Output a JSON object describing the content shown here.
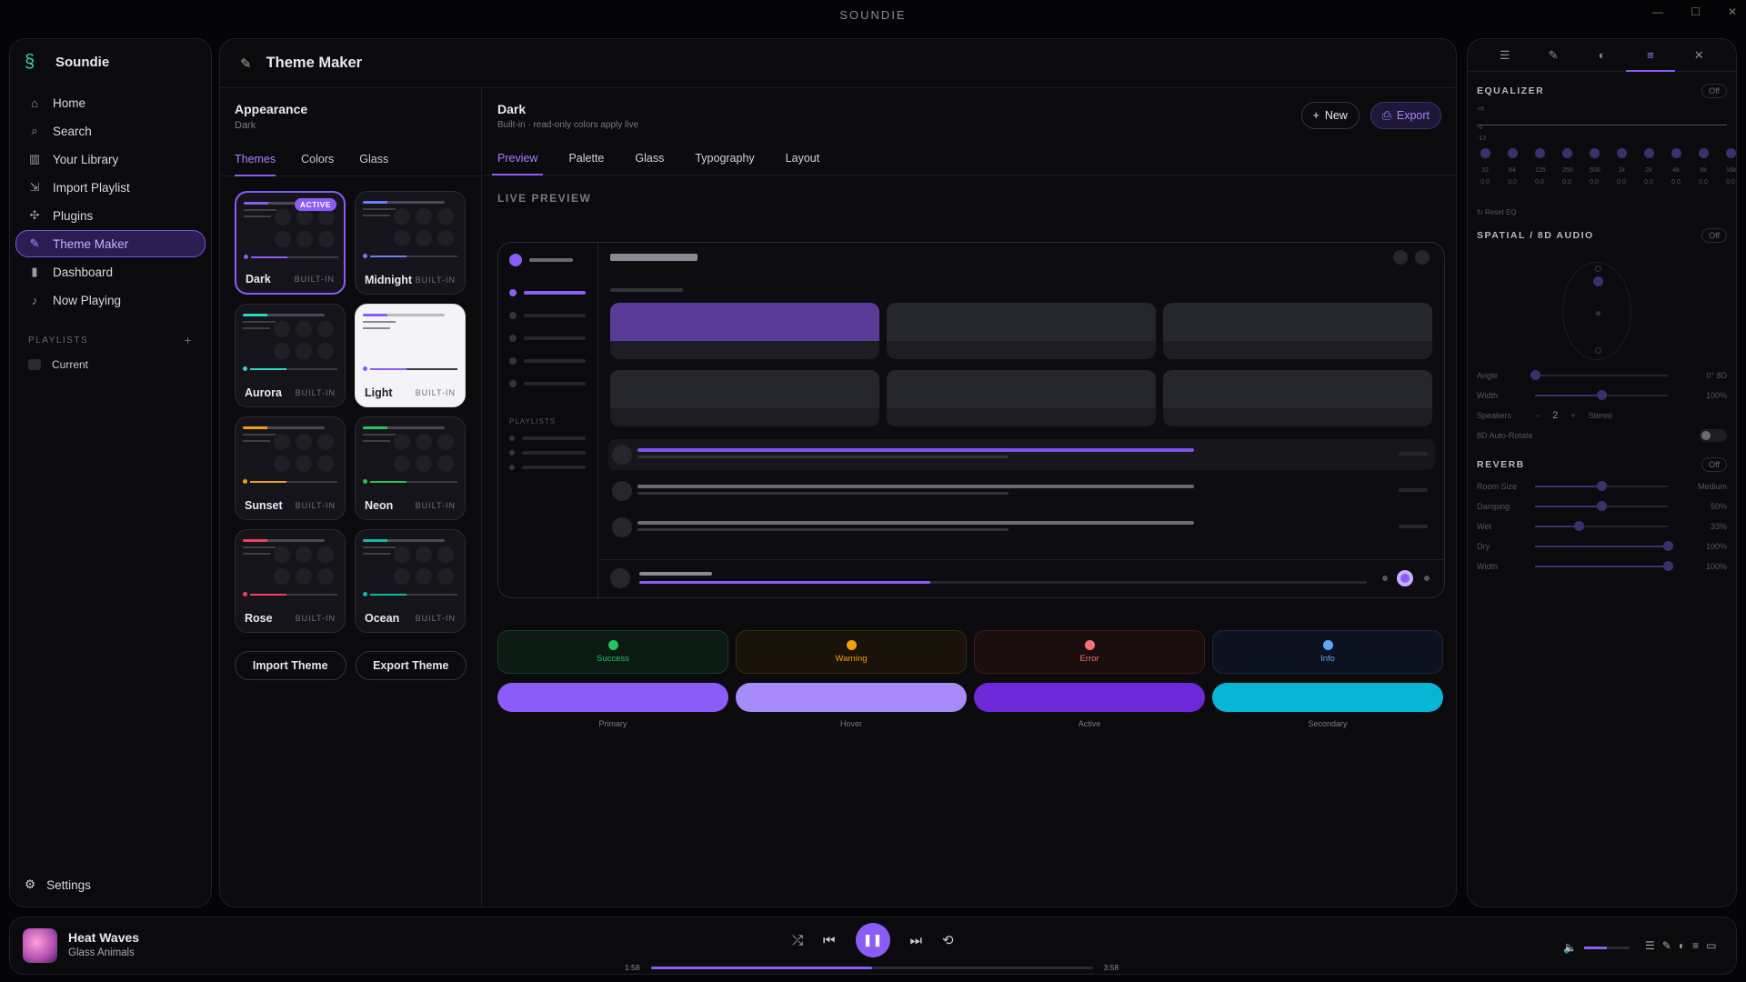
{
  "window": {
    "title": "SOUNDIE"
  },
  "colors": {
    "accent": "#8b5cf6",
    "bg": "#050507",
    "panel": "#0b0b0e"
  },
  "sidebar": {
    "app_name": "Soundie",
    "items": [
      {
        "label": "Home",
        "icon": "home-icon"
      },
      {
        "label": "Search",
        "icon": "search-icon"
      },
      {
        "label": "Your Library",
        "icon": "library-icon"
      },
      {
        "label": "Import Playlist",
        "icon": "import-icon"
      },
      {
        "label": "Plugins",
        "icon": "puzzle-icon"
      },
      {
        "label": "Theme Maker",
        "icon": "brush-icon",
        "active": true
      },
      {
        "label": "Dashboard",
        "icon": "chart-icon"
      },
      {
        "label": "Now Playing",
        "icon": "music-note-icon"
      }
    ],
    "playlists_heading": "PLAYLISTS",
    "playlists": [
      {
        "label": "Current"
      }
    ],
    "settings_label": "Settings"
  },
  "main": {
    "title": "Theme Maker",
    "appearance": {
      "title": "Appearance",
      "subtitle": "Dark"
    },
    "subtabs": [
      "Themes",
      "Colors",
      "Glass"
    ],
    "themes": [
      {
        "name": "Dark",
        "badge": "BUILT-IN",
        "active_label": "ACTIVE",
        "accent": "#8b5cf6"
      },
      {
        "name": "Midnight",
        "badge": "BUILT-IN",
        "accent": "#6b7cff"
      },
      {
        "name": "Aurora",
        "badge": "BUILT-IN",
        "accent": "#2dd4bf"
      },
      {
        "name": "Light",
        "badge": "BUILT-IN",
        "accent": "#8b5cf6"
      },
      {
        "name": "Sunset",
        "badge": "BUILT-IN",
        "accent": "#f59e0b"
      },
      {
        "name": "Neon",
        "badge": "BUILT-IN",
        "accent": "#22c55e"
      },
      {
        "name": "Rose",
        "badge": "BUILT-IN",
        "accent": "#f43f5e"
      },
      {
        "name": "Ocean",
        "badge": "BUILT-IN",
        "accent": "#14b8a6"
      }
    ],
    "import_label": "Import Theme",
    "export_theme_label": "Export Theme",
    "detail": {
      "title": "Dark",
      "subtitle": "Built-in · read-only colors apply live",
      "new_label": "New",
      "export_label": "Export"
    },
    "tabs": [
      "Preview",
      "Palette",
      "Glass",
      "Typography",
      "Layout"
    ],
    "live_preview_label": "LIVE PREVIEW",
    "preview_playlists_label": "PLAYLISTS",
    "status": [
      {
        "label": "Success",
        "color": "#22c55e"
      },
      {
        "label": "Warning",
        "color": "#f59e0b"
      },
      {
        "label": "Error",
        "color": "#f87171"
      },
      {
        "label": "Info",
        "color": "#60a5fa"
      }
    ],
    "swatches": [
      {
        "label": "Primary",
        "color": "#8b5cf6"
      },
      {
        "label": "Hover",
        "color": "#a78bfa"
      },
      {
        "label": "Active",
        "color": "#6d28d9"
      },
      {
        "label": "Secondary",
        "color": "#06b6d4"
      }
    ]
  },
  "rpanel": {
    "equalizer": {
      "title": "EQUALIZER",
      "off": "Off",
      "scale": [
        "+6",
        "-6",
        "-12"
      ],
      "bands": [
        "32",
        "64",
        "125",
        "250",
        "500",
        "1k",
        "2k",
        "4k",
        "8k",
        "16k"
      ],
      "values": [
        "0.0",
        "0.0",
        "0.0",
        "0.0",
        "0.0",
        "0.0",
        "0.0",
        "0.0",
        "0.0",
        "0.0"
      ],
      "reset": "Reset EQ"
    },
    "spatial": {
      "title": "SPATIAL / 8D AUDIO",
      "off": "Off",
      "angle": {
        "label": "Angle",
        "value": "0° 8D",
        "level": 0
      },
      "width": {
        "label": "Width",
        "value": "100%",
        "level": 0.5
      },
      "speakers": {
        "label": "Speakers",
        "value": "2",
        "unit": "Stereo"
      },
      "autorotate": "8D Auto-Rotate"
    },
    "reverb": {
      "title": "REVERB",
      "off": "Off",
      "sliders": [
        {
          "label": "Room Size",
          "value": "Medium",
          "level": 0.5
        },
        {
          "label": "Damping",
          "value": "50%",
          "level": 0.5
        },
        {
          "label": "Wet",
          "value": "33%",
          "level": 0.33
        },
        {
          "label": "Dry",
          "value": "100%",
          "level": 1
        },
        {
          "label": "Width",
          "value": "100%",
          "level": 1
        }
      ]
    }
  },
  "player": {
    "title": "Heat Waves",
    "artist": "Glass Animals",
    "elapsed": "1:58",
    "duration": "3:58",
    "progress": 0.5,
    "volume": 0.5
  }
}
